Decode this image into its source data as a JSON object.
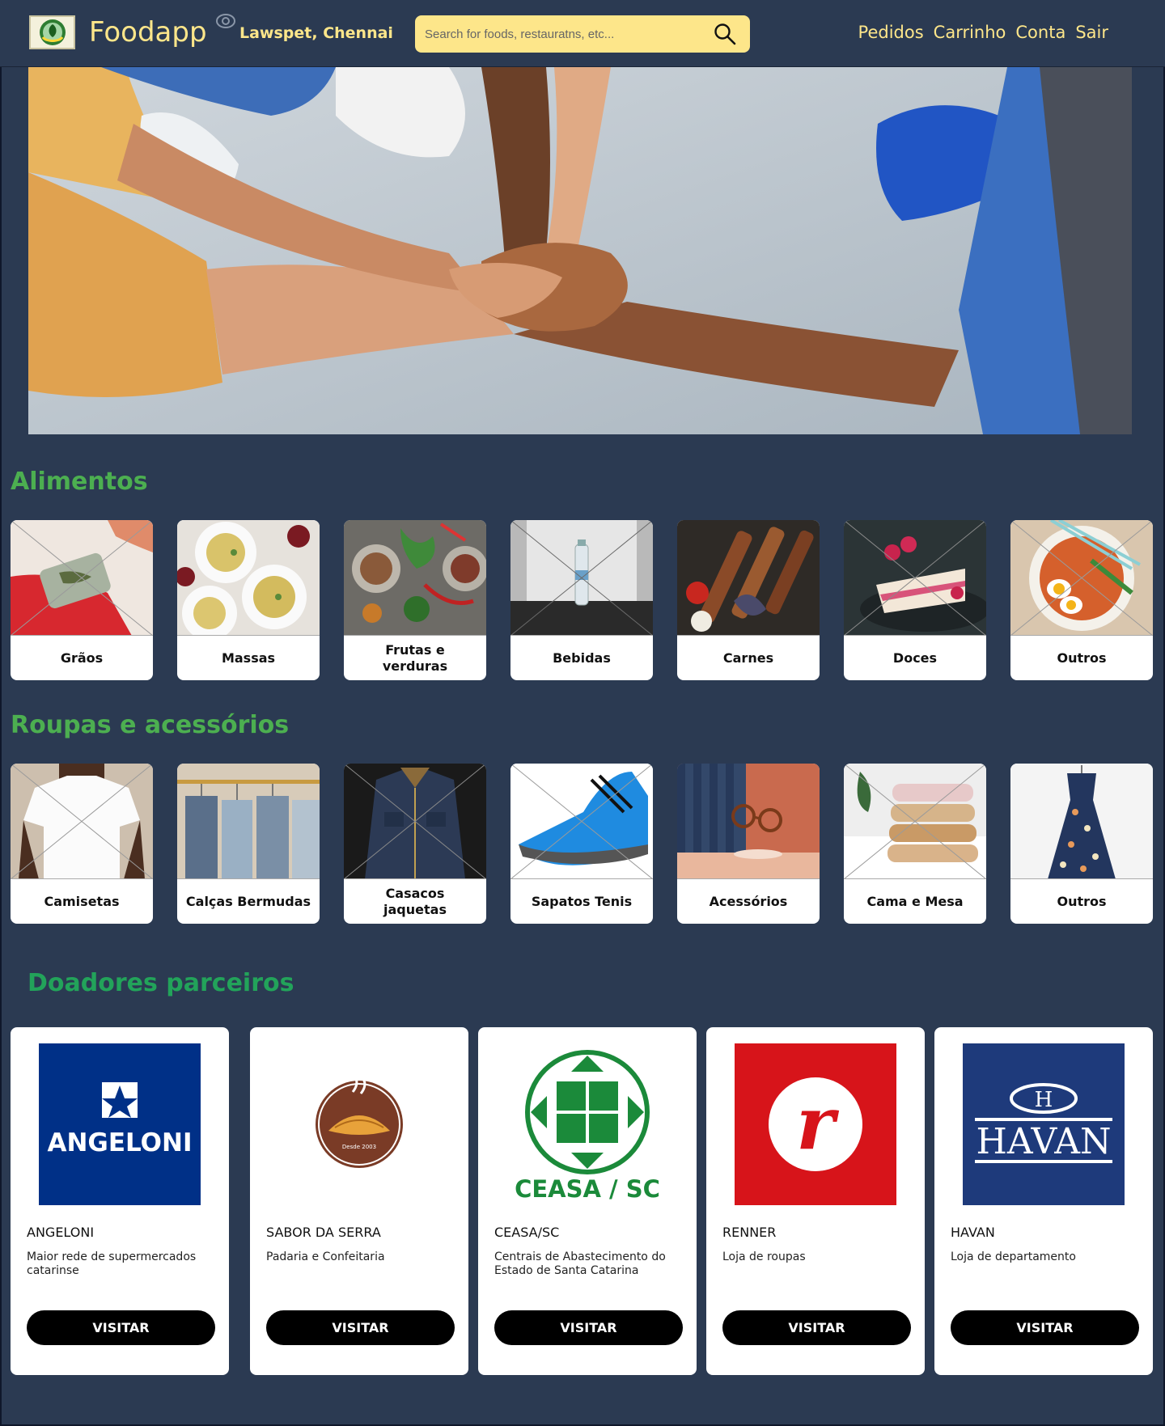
{
  "header": {
    "brand": "Foodapp",
    "location": "Lawspet, Chennai",
    "search_placeholder": "Search for foods, restauratns, etc...",
    "nav": [
      "Pedidos",
      "Carrinho",
      "Conta",
      "Sair"
    ]
  },
  "sections": {
    "food_title": "Alimentos",
    "clothes_title": "Roupas e acessórios",
    "donors_title": "Doadores parceiros"
  },
  "food_categories": [
    {
      "label": "Grãos",
      "icon": "red-bag-photo"
    },
    {
      "label": "Massas",
      "icon": "pasta-photo"
    },
    {
      "label": "Frutas e verduras",
      "icon": "vegetables-photo"
    },
    {
      "label": "Bebidas",
      "icon": "water-bottle-photo"
    },
    {
      "label": "Carnes",
      "icon": "meat-skewers-photo"
    },
    {
      "label": "Doces",
      "icon": "cake-photo"
    },
    {
      "label": "Outros",
      "icon": "ramen-photo"
    }
  ],
  "clothes_categories": [
    {
      "label": "Camisetas",
      "icon": "tshirt-photo"
    },
    {
      "label": "Calças Bermudas",
      "icon": "jeans-photo"
    },
    {
      "label": "Casacos jaquetas",
      "icon": "jacket-photo"
    },
    {
      "label": "Sapatos Tenis",
      "icon": "sneaker-photo"
    },
    {
      "label": "Acessórios",
      "icon": "glasses-photo"
    },
    {
      "label": "Cama e Mesa",
      "icon": "towels-photo"
    },
    {
      "label": "Outros",
      "icon": "dress-photo"
    }
  ],
  "donors": [
    {
      "name": "ANGELONI",
      "description": "Maior rede de supermercados catarinse",
      "button": "VISITAR",
      "logo_text": "ANGELONI",
      "color": "#003087"
    },
    {
      "name": "SABOR DA SERRA",
      "description": "Padaria e Confeitaria",
      "button": "VISITAR",
      "logo_text": "Desde 2003",
      "color": "#7a3b26"
    },
    {
      "name": "CEASA/SC",
      "description": "Centrais de Abastecimento do Estado de Santa Catarina",
      "button": "VISITAR",
      "logo_text": "CEASA / SC",
      "color": "#1b8a3a"
    },
    {
      "name": "RENNER",
      "description": "Loja de roupas",
      "button": "VISITAR",
      "logo_text": "r",
      "color": "#d7141a"
    },
    {
      "name": "HAVAN",
      "description": "Loja de departamento",
      "button": "VISITAR",
      "logo_text": "HAVAN",
      "color": "#1e3a7b"
    }
  ],
  "colors": {
    "background": "#2b3a52",
    "header_text": "#fde68a",
    "section_title": "#4caf50",
    "search_bg": "#fde68a"
  }
}
